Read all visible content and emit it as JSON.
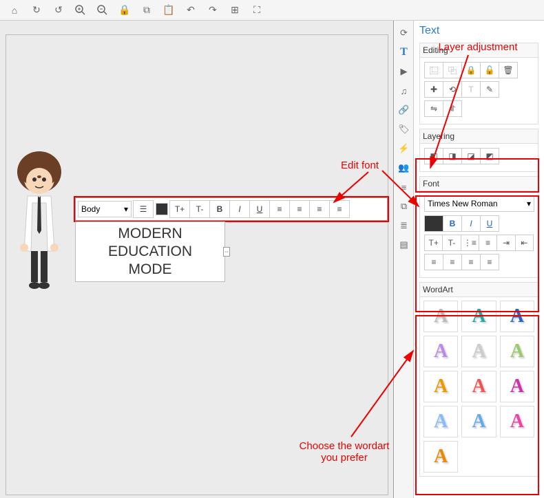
{
  "toolbar_top": {
    "home": "⌂",
    "redo": "↷",
    "undo": "↶",
    "zoom_in": "🔍+",
    "zoom_out": "🔍-",
    "lock": "🔒",
    "copy": "⧉",
    "paste": "📋",
    "back": "↶",
    "forward": "↷",
    "select": "⊞",
    "fit": "⛶"
  },
  "vtoolbar": [
    "⟳",
    "T",
    "▶",
    "♫",
    "🔗",
    "🏷",
    "⚡",
    "👥",
    "≡",
    "⧉",
    "≣",
    "▤"
  ],
  "panel_title": "Text",
  "editing": {
    "label": "Editing"
  },
  "layering": {
    "label": "Layering"
  },
  "font": {
    "label": "Font",
    "family": "Times New Roman",
    "bold": "B",
    "italic": "I",
    "underline": "U",
    "inc": "T+",
    "dec": "T-"
  },
  "wordart": {
    "label": "WordArt"
  },
  "text_toolbar": {
    "style": "Body",
    "bold": "B",
    "italic": "I",
    "underline": "U",
    "inc": "T+",
    "dec": "T-"
  },
  "textbox": {
    "line1": "MODERN",
    "line2": "EDUCATION",
    "line3": "MODE"
  },
  "annotations": {
    "layer": "Layer adjustment",
    "editfont": "Edit font",
    "wordart": "Choose the wordart\nyou prefer"
  },
  "wordart_colors": [
    "#bbb",
    "#2aa",
    "#26c",
    "#b8e",
    "#ccc",
    "#9c6",
    "#e90",
    "#e55",
    "#c3a",
    "#8bf",
    "#6ae",
    "#e4a",
    "#e80"
  ]
}
